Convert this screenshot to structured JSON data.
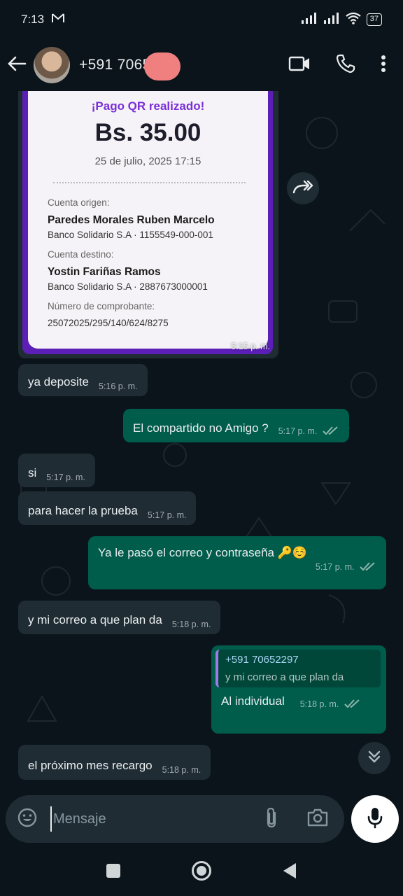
{
  "status_bar": {
    "time": "7:13",
    "battery": "37"
  },
  "header": {
    "contact": "+591 70652"
  },
  "receipt": {
    "title": "¡Pago QR realizado!",
    "amount": "Bs. 35.00",
    "date": "25 de julio, 2025 17:15",
    "origin_label": "Cuenta origen:",
    "origin_name": "Paredes Morales Ruben Marcelo",
    "origin_account": "Banco Solidario S.A · 1155549-000-001",
    "dest_label": "Cuenta destino:",
    "dest_name": "Yostin Fariñas Ramos",
    "dest_account": "Banco Solidario S.A · 2887673000001",
    "voucher_label": "Número de comprobante:",
    "voucher_number": "25072025/295/140/624/8275",
    "time": "5:15 p. m."
  },
  "messages": [
    {
      "text": "ya deposite",
      "time": "5:16 p. m."
    },
    {
      "text": "El compartido no Amigo ?",
      "time": "5:17 p. m."
    },
    {
      "text": "si",
      "time": "5:17 p. m."
    },
    {
      "text": "para hacer la prueba",
      "time": "5:17 p. m."
    },
    {
      "text": "Ya le pasó el correo y contraseña 🔑☺️",
      "time": "5:17 p. m."
    },
    {
      "text": "y mi correo a que plan da",
      "time": "5:18 p. m."
    },
    {
      "text": "Al individual",
      "time": "5:18 p. m.",
      "reply_name": "+591 70652297",
      "reply_text": "y mi correo a que plan da"
    },
    {
      "text": "el próximo mes recargo",
      "time": "5:18 p. m."
    }
  ],
  "composer": {
    "placeholder": "Mensaje"
  },
  "colors": {
    "background": "#0b141a",
    "incoming": "#1f2c33",
    "outgoing": "#005c4b",
    "receipt_accent": "#5b1fb8"
  }
}
